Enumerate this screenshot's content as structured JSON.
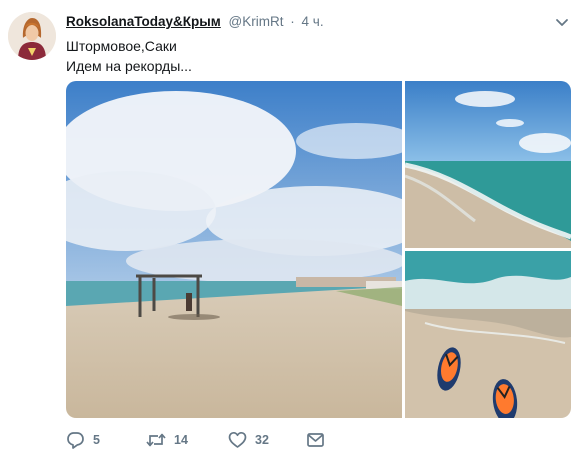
{
  "tweet": {
    "author_name": "RoksolanaToday&Крым",
    "screen_name": "@KrimRt",
    "separator": "·",
    "time": "4 ч.",
    "text_lines": [
      "Штормовое,Саки",
      "Идем на рекорды..."
    ]
  },
  "actions": {
    "replies": "5",
    "retweets": "14",
    "likes": "32"
  },
  "media": {
    "photos": [
      "beach-photo",
      "sea-shore-photo",
      "flip-flops-photo"
    ]
  },
  "colors": {
    "name": "#14171a",
    "meta": "#657786",
    "icon": "#657786"
  },
  "icons": [
    "caret-down-icon",
    "reply-icon",
    "retweet-icon",
    "like-icon",
    "direct-message-icon"
  ]
}
